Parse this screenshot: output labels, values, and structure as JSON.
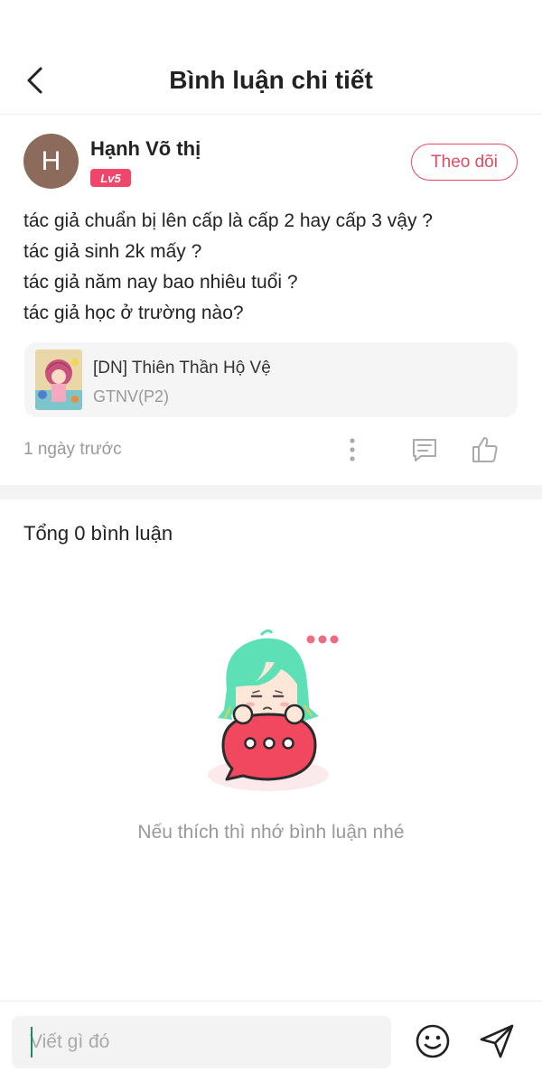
{
  "header": {
    "title": "Bình luận chi tiết",
    "back_icon": "chevron-left-icon"
  },
  "comment": {
    "avatar_letter": "H",
    "avatar_color": "#8c6a5c",
    "username": "Hạnh Võ thị",
    "level": "Lv5",
    "follow_label": "Theo dõi",
    "lines": [
      "tác giả chuẩn bị lên cấp là cấp 2 hay cấp 3 vậy ?",
      "tác giả sinh 2k mấy ?",
      "tác giả năm nay bao nhiêu tuổi ?",
      "tác giả học ở trường nào?"
    ],
    "book": {
      "title": "[DN] Thiên Thần Hộ Vệ",
      "author": "GTNV(P2)"
    },
    "timestamp": "1 ngày trước"
  },
  "comments_section": {
    "total_label": "Tổng 0 bình luận",
    "empty_text": "Nếu thích thì nhớ bình luận nhé"
  },
  "composer": {
    "placeholder": "Viết gì đó",
    "emoji_icon": "smiley-icon",
    "send_icon": "send-icon"
  },
  "colors": {
    "accent": "#e34a62",
    "badge": "#f2456a",
    "mascot_hair": "#5ee0b6",
    "bubble": "#f2485f"
  }
}
